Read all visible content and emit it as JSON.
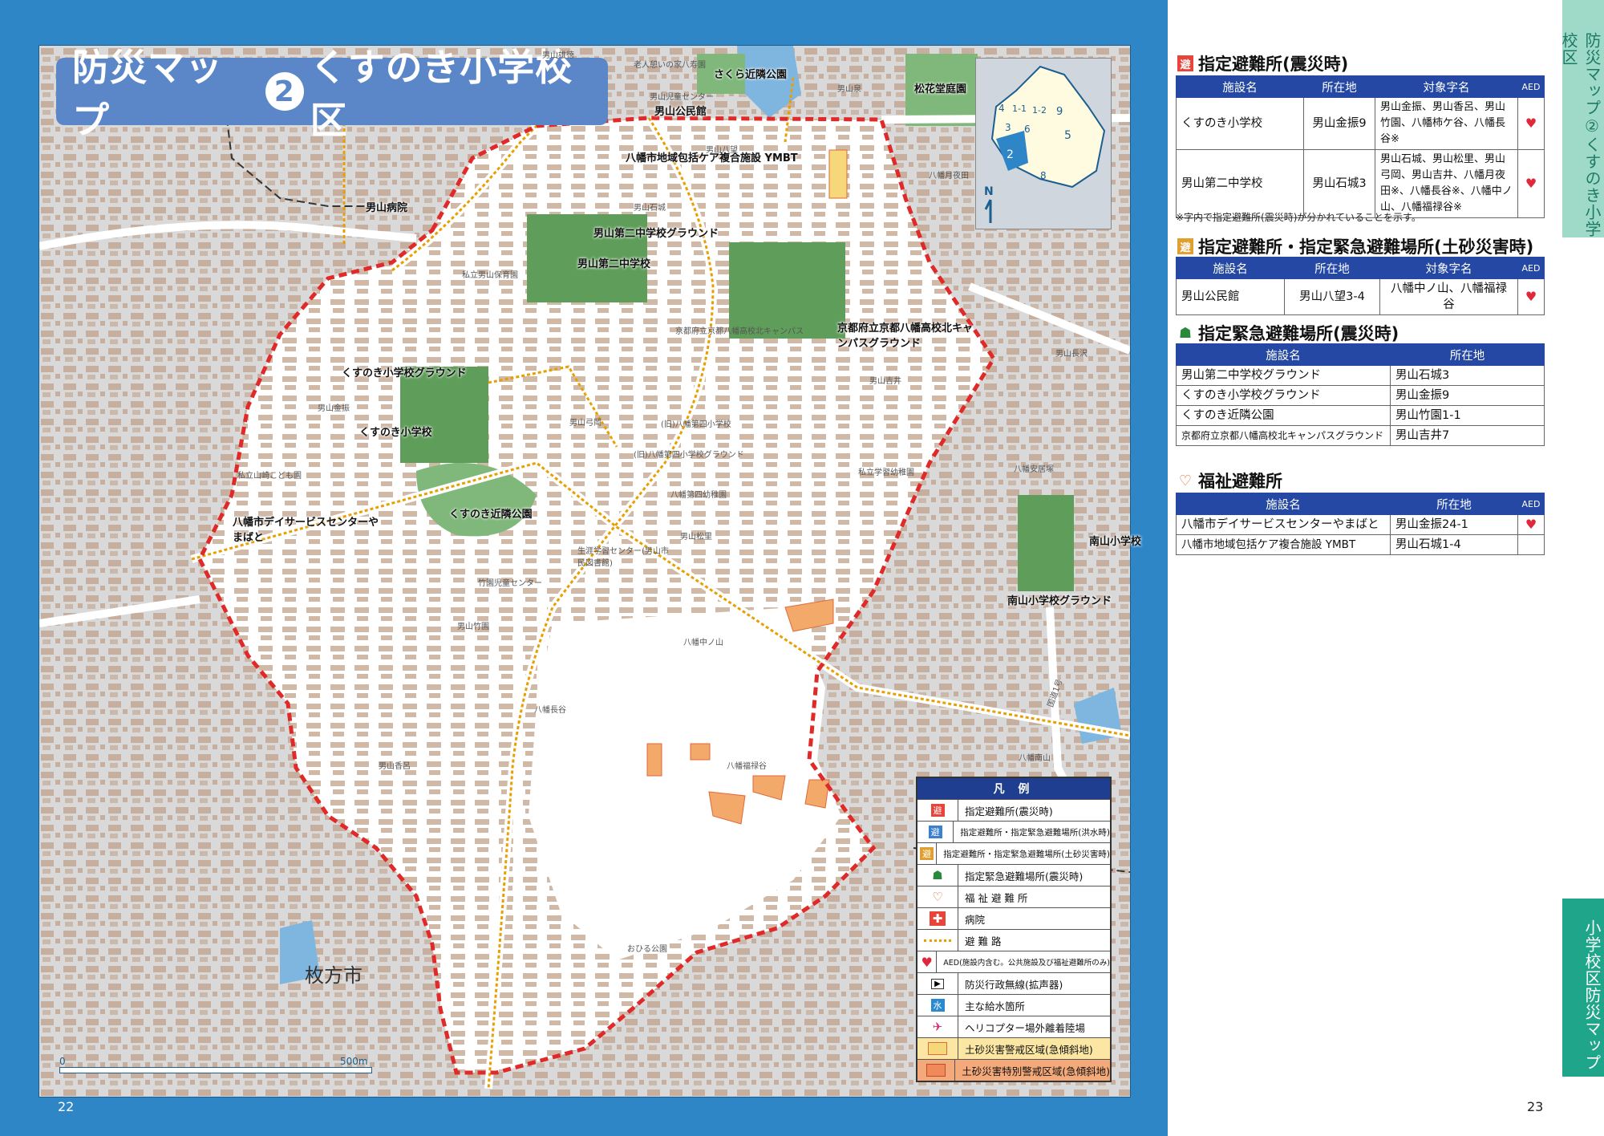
{
  "map": {
    "title_prefix": "防災マップ",
    "title_num": "2",
    "title_main": "くすのき小学校区",
    "city": "枚方市",
    "page_left": "22",
    "scale_start": "0",
    "scale_end": "500m",
    "inset_labels": [
      "9",
      "4",
      "1",
      "1-2",
      "3",
      "6",
      "5",
      "2",
      "8"
    ],
    "facilities": [
      {
        "name": "八幡市地域包括ケア複合施設 YMBT"
      },
      {
        "name": "男山第二中学校グラウンド"
      },
      {
        "name": "男山第二中学校"
      },
      {
        "name": "京都府立京都八幡高校北キャンパスグラウンド"
      },
      {
        "name": "くすのき小学校グラウンド"
      },
      {
        "name": "くすのき小学校"
      },
      {
        "name": "くすのき近隣公園"
      },
      {
        "name": "八幡市デイサービスセンターやまばと"
      },
      {
        "name": "南山小学校"
      },
      {
        "name": "南山小学校グラウンド"
      },
      {
        "name": "松花堂庭園"
      },
      {
        "name": "さくら近隣公園"
      },
      {
        "name": "男山公民館"
      },
      {
        "name": "男山病院"
      }
    ],
    "minor_labels": {
      "l1": "老人憩いの家八寿園",
      "l2": "男山児童センター",
      "l3": "私立男山保育園",
      "l4": "京都府立京都八幡高校北キャンパス",
      "l5": "(旧)八幡第四小学校",
      "l6": "(旧)八幡第四小学校グラウンド",
      "l7": "八幡第四幼稚園",
      "l8": "私立学習幼稚園",
      "l9": "私立山崎こども園",
      "l10": "生涯学習センター(男山市民図書館)",
      "l11": "竹園児童センター",
      "l12": "おひる公園",
      "l13": "八幡中ノ山",
      "l14": "八幡福禄谷",
      "l15": "男山竹園",
      "l16": "男山香呂",
      "l17": "男山石城",
      "l18": "男山吉井",
      "l19": "男山弓岡",
      "l20": "男山松里",
      "l21": "八幡長谷",
      "l22": "男山雄徳",
      "l23": "男山泉",
      "l24": "男山八望",
      "l25": "八幡月夜田",
      "l26": "八幡安居塚",
      "l27": "男山長沢",
      "l28": "男山金振",
      "l29": "八幡南山",
      "l30": "国道1号"
    },
    "legend": {
      "title": "凡 例",
      "items": [
        "指定避難所(震災時)",
        "指定避難所・指定緊急避難場所(洪水時)",
        "指定避難所・指定緊急避難場所(土砂災害時)",
        "指定緊急避難場所(震災時)",
        "福 祉 避 難 所",
        "病院",
        "避 難 路",
        "AED(施設内含む。公共施設及び福祉避難所のみ)",
        "防災行政無線(拡声器)",
        "主な給水箇所",
        "ヘリコプター場外離着陸場",
        "土砂災害警戒区域(急傾斜地)",
        "土砂災害特別警戒区域(急傾斜地)"
      ]
    },
    "colors": {
      "boundary": "#e02a2a",
      "route": "#e8a000",
      "park": "#5f9e5a",
      "water": "#7fb6e0",
      "page_bg": "#2e86c7"
    }
  },
  "right": {
    "page_right": "23",
    "side_tab_top": "防災マップ②くすのき小学校区",
    "side_tab_bottom": "小学校区防災マップ",
    "sec1": {
      "title": "指定避難所(震災時)",
      "headers": [
        "施設名",
        "所在地",
        "対象字名",
        "AED"
      ],
      "rows": [
        {
          "name": "くすのき小学校",
          "addr": "男山金振9",
          "area": "男山金振、男山香呂、男山竹園、八幡柿ケ谷、八幡長谷※",
          "aed": "♥"
        },
        {
          "name": "男山第二中学校",
          "addr": "男山石城3",
          "area": "男山石城、男山松里、男山弓岡、男山吉井、八幡月夜田※、八幡長谷※、八幡中ノ山、八幡福禄谷※",
          "aed": "♥"
        }
      ],
      "note": "※字内で指定避難所(震災時)が分かれていることを示す。"
    },
    "sec2": {
      "title": "指定避難所・指定緊急避難場所(土砂災害時)",
      "headers": [
        "施設名",
        "所在地",
        "対象字名",
        "AED"
      ],
      "rows": [
        {
          "name": "男山公民館",
          "addr": "男山八望3-4",
          "area": "八幡中ノ山、八幡福禄谷",
          "aed": "♥"
        }
      ]
    },
    "sec3": {
      "title": "指定緊急避難場所(震災時)",
      "headers": [
        "施設名",
        "所在地"
      ],
      "rows": [
        {
          "name": "男山第二中学校グラウンド",
          "addr": "男山石城3"
        },
        {
          "name": "くすのき小学校グラウンド",
          "addr": "男山金振9"
        },
        {
          "name": "くすのき近隣公園",
          "addr": "男山竹園1-1"
        },
        {
          "name": "京都府立京都八幡高校北キャンパスグラウンド",
          "addr": "男山吉井7"
        }
      ]
    },
    "sec4": {
      "title": "福祉避難所",
      "headers": [
        "施設名",
        "所在地",
        "AED"
      ],
      "rows": [
        {
          "name": "八幡市デイサービスセンターやまばと",
          "addr": "男山金振24-1",
          "aed": "♥"
        },
        {
          "name": "八幡市地域包括ケア複合施設 YMBT",
          "addr": "男山石城1-4",
          "aed": ""
        }
      ]
    }
  }
}
